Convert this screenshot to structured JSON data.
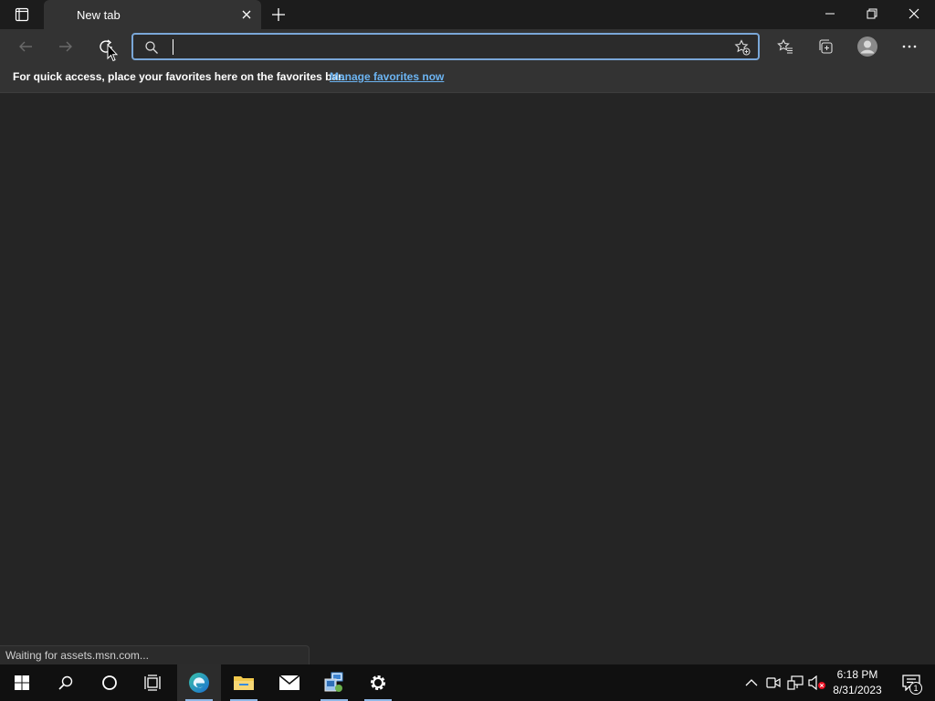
{
  "browser": {
    "tab": {
      "title": "New tab"
    },
    "address_bar": {
      "value": "",
      "placeholder": ""
    },
    "favorites_bar": {
      "message": "For quick access, place your favorites here on the favorites bar.",
      "link": "Manage favorites now"
    },
    "status": "Waiting for assets.msn.com..."
  },
  "icons": {
    "titlebar": [
      "tab-actions-icon",
      "close-icon",
      "plus-icon",
      "minimize-icon",
      "restore-icon",
      "close-icon"
    ],
    "toolbar": [
      "back-arrow-icon",
      "forward-arrow-icon",
      "refresh-icon",
      "search-icon",
      "add-favorite-icon",
      "favorites-icon",
      "collections-icon",
      "profile-avatar-icon",
      "more-icon"
    ],
    "taskbar": [
      "windows-start-icon",
      "search-icon",
      "cortana-icon",
      "task-view-icon",
      "edge-icon",
      "file-explorer-icon",
      "mail-icon",
      "network-app-icon",
      "settings-icon"
    ],
    "tray": [
      "chevron-up-icon",
      "meet-now-icon",
      "network-icon",
      "volume-muted-icon",
      "notifications-icon"
    ]
  },
  "taskbar": {
    "clock": {
      "time": "6:18 PM",
      "date": "8/31/2023"
    },
    "notifications_count": "1"
  },
  "colors": {
    "accent": "#7aa7d8",
    "link": "#6cb4f2",
    "background": "#252525",
    "taskbar": "#101010"
  }
}
